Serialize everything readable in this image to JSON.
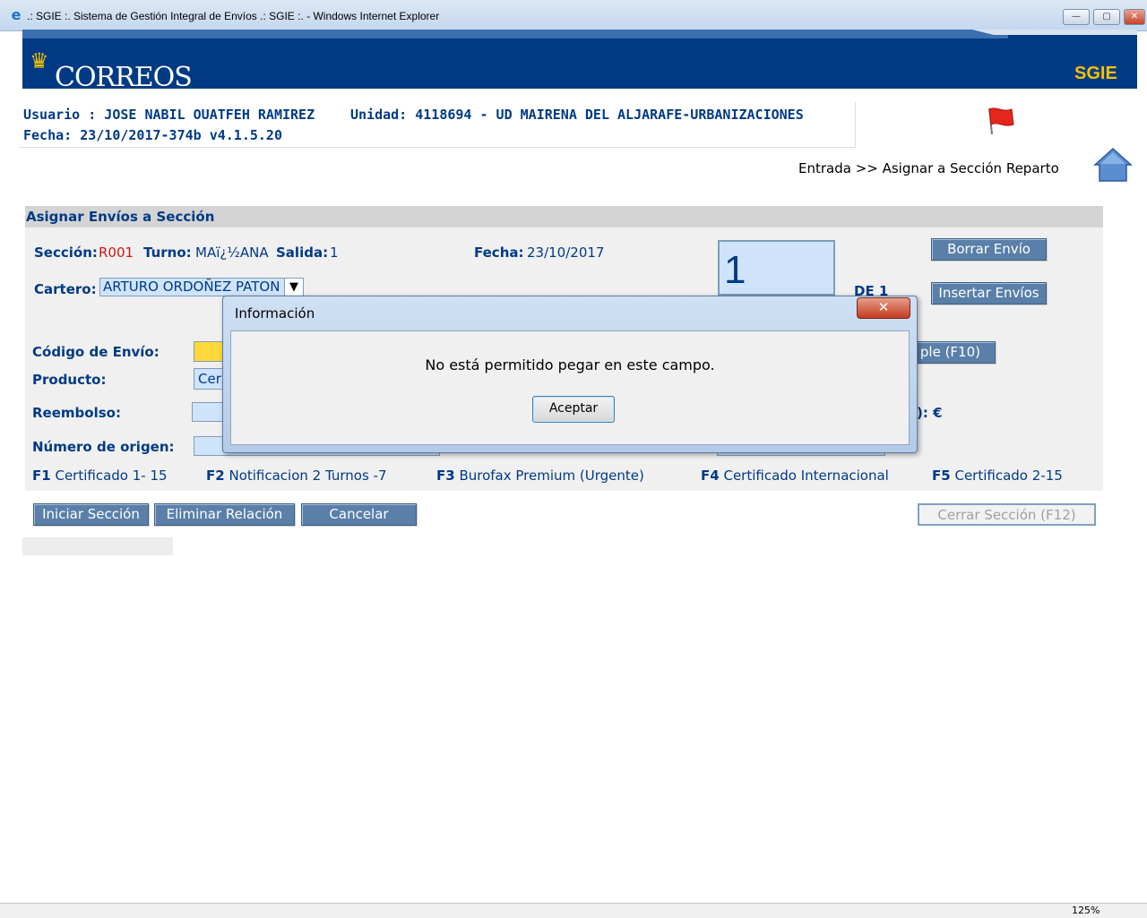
{
  "window": {
    "title": ".: SGIE :. Sistema de Gestión Integral de Envíos .: SGIE :. - Windows Internet Explorer",
    "minimize": "—",
    "restore": "▢",
    "close": "✕"
  },
  "header": {
    "logo_text": "CORREOS",
    "app_label": "SGIE"
  },
  "user_info": {
    "usuario": "Usuario : JOSE NABIL OUATFEH RAMIREZ",
    "unidad": "Unidad: 4118694 - UD MAIRENA DEL ALJARAFE-URBANIZACIONES",
    "fecha": "Fecha: 23/10/2017-374b v4.1.5.20"
  },
  "breadcrumb": "Entrada >> Asignar a Sección Reparto",
  "panel": {
    "title": "Asignar Envíos a Sección",
    "seccion_label": "Sección:",
    "seccion_value": "R001",
    "turno_label": "Turno:",
    "turno_value": "MAï¿½ANA",
    "salida_label": "Salida:",
    "salida_value": "1",
    "fecha_label": "Fecha:",
    "fecha_value": "23/10/2017",
    "cartero_label": "Cartero:",
    "cartero_value": "ARTURO ORDOÑEZ PATON",
    "counter_value": "1",
    "de_label": "DE 1",
    "codigo_label": "Código de Envío:",
    "producto_label": "Producto:",
    "producto_value": "Cer",
    "reembolso_label": "Reembolso:",
    "reembolso_suffix": "): €",
    "numero_origen_label": "Número de origen:",
    "multiple_button_partial": "ple (F10)"
  },
  "buttons": {
    "borrar_envio": "Borrar Envío",
    "insertar_envios": "Insertar Envíos",
    "iniciar_seccion": "Iniciar Sección",
    "eliminar_relacion": "Eliminar Relación",
    "cancelar": "Cancelar",
    "cerrar_seccion": "Cerrar Sección (F12)"
  },
  "function_keys": [
    {
      "key": "F1",
      "label": "Certificado 1- 15"
    },
    {
      "key": "F2",
      "label": "Notificacion 2 Turnos -7"
    },
    {
      "key": "F3",
      "label": "Burofax Premium (Urgente)"
    },
    {
      "key": "F4",
      "label": "Certificado Internacional"
    },
    {
      "key": "F5",
      "label": "Certificado 2-15"
    }
  ],
  "dialog": {
    "title": "Información",
    "message": "No está permitido pegar en este campo.",
    "ok_button": "Aceptar",
    "close": "✕"
  },
  "statusbar": {
    "zoom": "125%"
  },
  "colors": {
    "brand_blue": "#003a85",
    "brand_yellow": "#f6c300",
    "button_blue": "#5a7fa8",
    "field_blue": "#cfe4fb",
    "field_highlight": "#ffd83a",
    "seccion_red": "#d01818"
  }
}
